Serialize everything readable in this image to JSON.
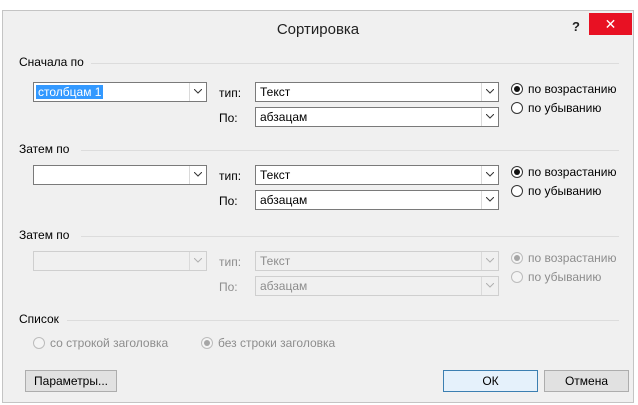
{
  "window": {
    "title": "Сортировка",
    "help": "?",
    "close": "✕"
  },
  "sections": [
    {
      "heading": "Сначала по",
      "column": "столбцам 1",
      "type_label": "тип:",
      "type_value": "Текст",
      "by_label": "По:",
      "by_value": "абзацам",
      "asc": "по возрастанию",
      "desc": "по убыванию",
      "order": "asc",
      "enabled": true
    },
    {
      "heading": "Затем по",
      "column": "",
      "type_label": "тип:",
      "type_value": "Текст",
      "by_label": "По:",
      "by_value": "абзацам",
      "asc": "по возрастанию",
      "desc": "по убыванию",
      "order": "asc",
      "enabled": true
    },
    {
      "heading": "Затем по",
      "column": "",
      "type_label": "тип:",
      "type_value": "Текст",
      "by_label": "По:",
      "by_value": "абзацам",
      "asc": "по возрастанию",
      "desc": "по убыванию",
      "order": "asc",
      "enabled": false
    }
  ],
  "list": {
    "heading": "Список",
    "with_header": "со строкой заголовка",
    "without_header": "без строки заголовка",
    "selected": "without_header"
  },
  "buttons": {
    "options": "Параметры...",
    "ok": "ОК",
    "cancel": "Отмена"
  }
}
